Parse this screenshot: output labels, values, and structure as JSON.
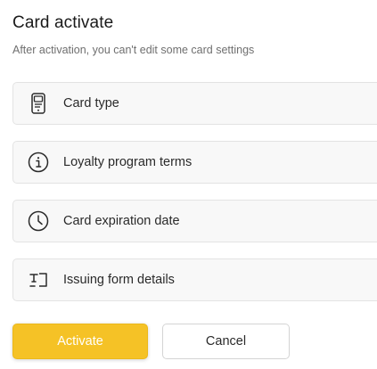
{
  "dialog": {
    "title": "Card activate",
    "subtitle": "After activation, you can't edit some card settings"
  },
  "sections": [
    {
      "label": "Card type",
      "icon": "phone-card-icon"
    },
    {
      "label": "Loyalty program terms",
      "icon": "info-circle-icon"
    },
    {
      "label": "Card expiration date",
      "icon": "clock-icon"
    },
    {
      "label": "Issuing form details",
      "icon": "text-form-icon"
    }
  ],
  "actions": {
    "activate_label": "Activate",
    "cancel_label": "Cancel"
  },
  "colors": {
    "accent": "#f5c226",
    "section_bg": "#f8f8f8",
    "border": "#e3e3e3"
  }
}
